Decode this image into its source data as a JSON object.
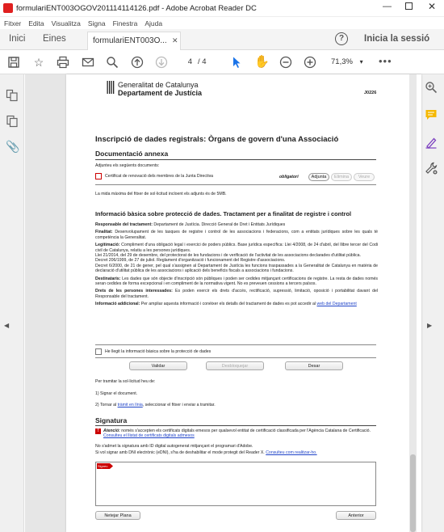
{
  "window": {
    "title": "formulariENT003OGOV201114114126.pdf - Adobe Acrobat Reader DC"
  },
  "menu": [
    "Fitxer",
    "Edita",
    "Visualitza",
    "Signa",
    "Finestra",
    "Ajuda"
  ],
  "tabs": {
    "home": "Inici",
    "tools": "Eines",
    "document": "formulariENT003O...",
    "signin": "Inicia la sessió"
  },
  "toolbar": {
    "page_current": "4",
    "page_total": "/ 4",
    "zoom": "71,3%"
  },
  "doc": {
    "org1": "Generalitat de Catalunya",
    "org2": "Departament de Justícia",
    "form_code": "J0226",
    "title": "Inscripció de dades registrals: Òrgans de govern d'una Associació",
    "sec_docs": "Documentació annexa",
    "docs_instr": "Adjunteu els següents documents:",
    "doc_item": "Certificat de renovació dels membres de la Junta Directiva",
    "obligatori": "obligatori",
    "btn_adjunta": "Adjunta",
    "btn_elimina": "Elimina",
    "btn_veure": "Veure",
    "size_note": "La mida màxima del fitxer de sol·licitud incloent els adjunts és de 5MB.",
    "sec_data": "Informació bàsica sobre protecció de dades. Tractament per a finalitat de registre i control",
    "p_resp_label": "Responsable del tractament:",
    "p_resp": " Departament de Justícia. Direcció General de Dret i Entitats Jurídiques",
    "p_fin_label": "Finalitat:",
    "p_fin": " Desenvolupament de les tasques de registre i control de les associacions i federacions, com a entitats jurídiques sobre les quals té competència la Generalitat.",
    "p_leg_label": "Legitimació:",
    "p_leg": " Compliment d'una obligació legal i exercici de poders públics. Base jurídica específica: Llei 4/2008, de 24 d'abril, del llibre tercer del Codi civil de Catalunya, relatiu a les persones jurídiques.",
    "p_leg2": "Llei 21/2014, del 29 de desembre, del protectorat de les fundacions i de verificació de l'activitat de les associacions declarades d'utilitat pública.",
    "p_leg3": "Decret 206/1999, de 27 de juliol. Reglament d'organització i funcionament del Registre d'associacions.",
    "p_leg4": "Decret 6/2000, de 21 de gener, pel qual s'assignen al Departament de Justícia les funcions traspassades a la Generalitat de Catalunya en matèria de declaració d'utilitat pública de les associacions i aplicació dels beneficis fiscals a associacions i fundacions.",
    "p_dest_label": "Destinataris:",
    "p_dest": " Les dades que són objecte d'inscripció són públiques i poden ser cedides mitjançant certificacions de registre. La resta de dades només seran cedides de forma excepcional i en compliment de la normativa vigent. No es preveuen cessions a tercers països.",
    "p_drets_label": "Drets de les persones interessades:",
    "p_drets": " Es poden exercir els drets d'accés, rectificació, supressió, limitació, oposició i portabilitat davant del Responsable del tractament.",
    "p_info_label": "Informació addicional:",
    "p_info": " Per ampliar aquesta informació i conèixer els detalls del tractament de dades es pot accedir al ",
    "p_info_link": "web del Departament",
    "chk_label": "He llegit la informació bàsica sobre la protecció de dades",
    "btn_validar": "Validar",
    "btn_desbloquejar": "Desbloquejar",
    "btn_desar": "Desar",
    "instr": "Per tramitar la sol·licitud heu de:",
    "step1": "1)  Signar el document.",
    "step2_a": "2)  Tornar al ",
    "step2_link": "tràmit en línia",
    "step2_b": ", seleccionar el fitxer i enviar a tramitar.",
    "sec_sign": "Signatura",
    "att_label": "Atenció:",
    "att_text": " només s'accepten els certificats digitals emesos per qualsevol entitat de certificació classificada per l'Agència Catalana de Certificació. ",
    "att_link": "Consulteu el llistat de certificats digitals admesos",
    "sign_line2": "No s'admet la signatura amb ID digital autogenerat mitjançant el programari d'Adobe.",
    "sign_line3_a": "Si vol signar amb DNI electrònic (eDNI), s'ha de deshabilitar el mode protegit del Reader X. ",
    "sign_line3_link": "Consulteu com realitzar-ho.",
    "sign_tag": "Signeu",
    "btn_netejar": "Netejar Plana",
    "btn_anterior": "Anterior"
  },
  "colors": {
    "accent_blue": "#1a73e8",
    "required_red": "#cc0000",
    "link_blue": "#2044c8"
  }
}
